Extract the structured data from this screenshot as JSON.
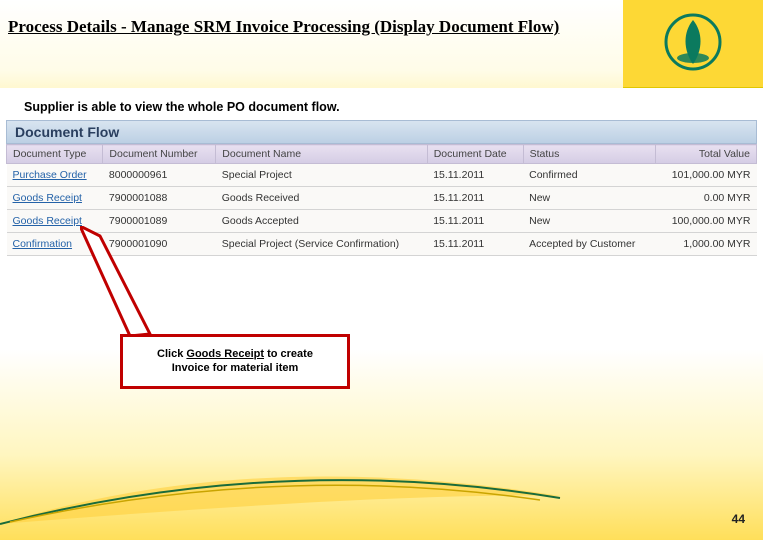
{
  "slide": {
    "title": "Process Details - Manage SRM Invoice Processing (Display Document Flow)",
    "subtitle": "Supplier is able to view the whole PO document flow.",
    "page_number": "44"
  },
  "section": {
    "header": "Document Flow"
  },
  "table": {
    "columns": [
      "Document Type",
      "Document Number",
      "Document Name",
      "Document Date",
      "Status",
      "Total Value"
    ],
    "rows": [
      {
        "type": "Purchase Order",
        "num": "8000000961",
        "name": "Special Project",
        "date": "15.11.2011",
        "status": "Confirmed",
        "value": "101,000.00 MYR"
      },
      {
        "type": "Goods Receipt",
        "num": "7900001088",
        "name": "Goods Received",
        "date": "15.11.2011",
        "status": "New",
        "value": "0.00 MYR"
      },
      {
        "type": "Goods Receipt",
        "num": "7900001089",
        "name": "Goods Accepted",
        "date": "15.11.2011",
        "status": "New",
        "value": "100,000.00 MYR"
      },
      {
        "type": "Confirmation",
        "num": "7900001090",
        "name": "Special Project (Service Confirmation)",
        "date": "15.11.2011",
        "status": "Accepted by Customer",
        "value": "1,000.00 MYR"
      }
    ]
  },
  "callout": {
    "prefix": "Click ",
    "link": "Goods Receipt",
    "suffix": " to create Invoice for material item"
  },
  "logo": {
    "name": "petronas-logo"
  }
}
